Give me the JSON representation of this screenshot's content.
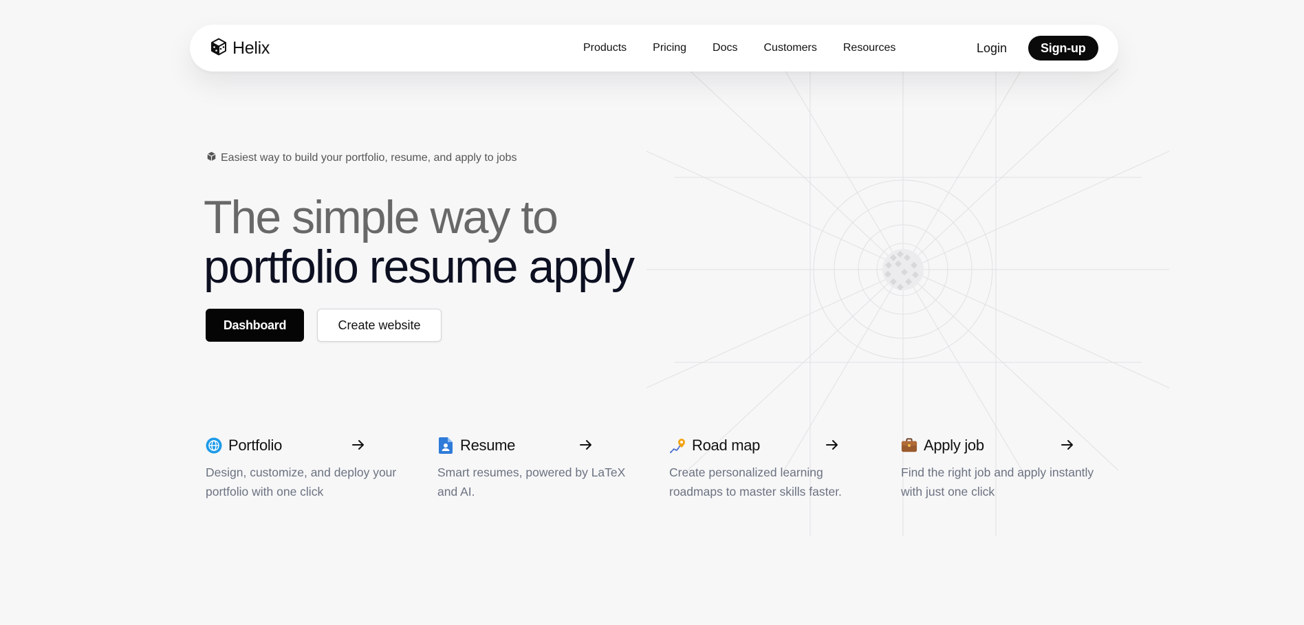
{
  "brand": {
    "name": "Helix"
  },
  "nav": {
    "links": [
      "Products",
      "Pricing",
      "Docs",
      "Customers",
      "Resources"
    ],
    "login_label": "Login",
    "signup_label": "Sign-up"
  },
  "hero": {
    "tagline": "Easiest way to build your portfolio, resume, and apply to jobs",
    "headline_line1": "The simple way to",
    "headline_line2": "portfolio resume apply",
    "primary_button": "Dashboard",
    "secondary_button": "Create website"
  },
  "features": [
    {
      "title": "Portfolio",
      "icon": "globe-icon",
      "description": "Design, customize, and deploy your portfolio with one click"
    },
    {
      "title": "Resume",
      "icon": "document-icon",
      "description": "Smart resumes, powered by LaTeX and AI."
    },
    {
      "title": "Road map",
      "icon": "route-pin-icon",
      "description": "Create personalized learning roadmaps to master skills faster."
    },
    {
      "title": "Apply job",
      "icon": "briefcase-icon",
      "description": "Find the right job and apply instantly with just one click"
    }
  ],
  "colors": {
    "background": "#f7f7f8",
    "accent": "#0a0a0a",
    "headline_muted": "#686868",
    "headline_dark": "#0d1021"
  }
}
